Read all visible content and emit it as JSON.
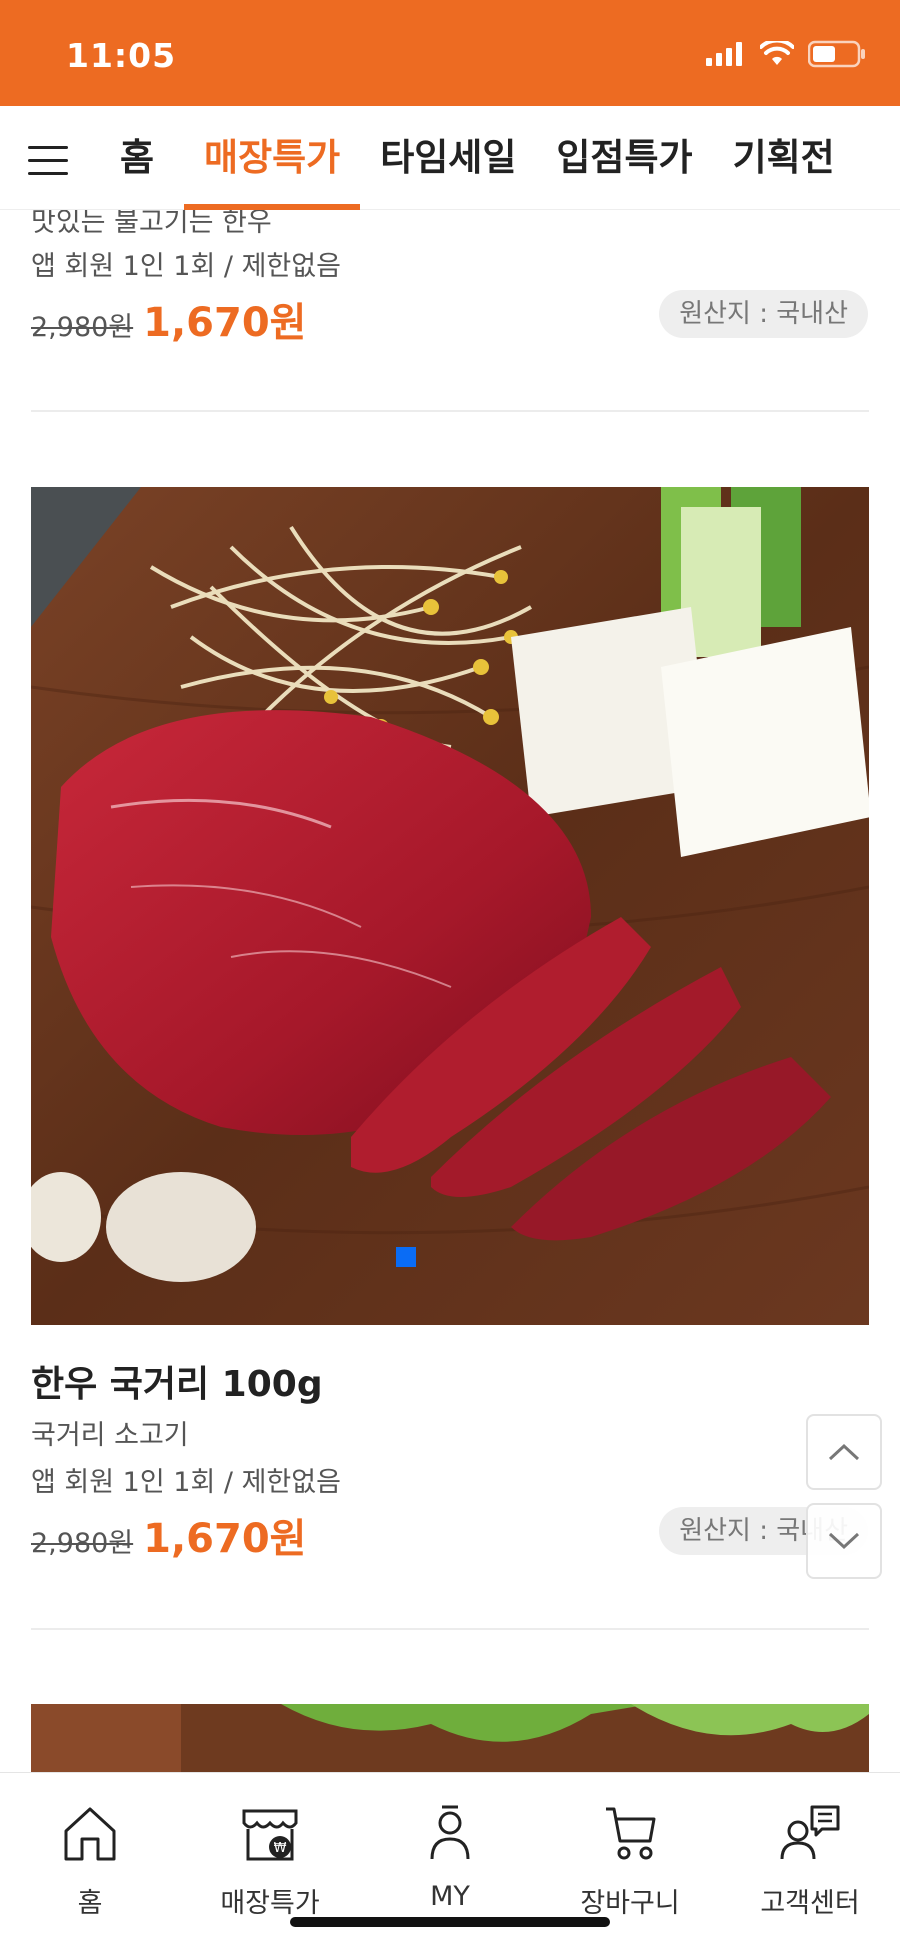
{
  "status_bar": {
    "time": "11:05",
    "icons": [
      "signal-icon",
      "wifi-icon",
      "battery-icon"
    ],
    "color": "#ed6b22"
  },
  "top_nav": {
    "menu_icon": "menu-icon",
    "tabs": [
      {
        "label": "홈",
        "active": false
      },
      {
        "label": "매장특가",
        "active": true
      },
      {
        "label": "타임세일",
        "active": false
      },
      {
        "label": "입점특가",
        "active": false
      },
      {
        "label": "기획전",
        "active": false
      }
    ],
    "accent": "#ed6b22"
  },
  "products": [
    {
      "description": "맛있는 불고기는 한우",
      "limit": "앱 회원 1인 1회 / 제한없음",
      "original_price": "2,980원",
      "sale_price": "1,670원",
      "origin": "원산지 : 국내산"
    },
    {
      "title": "한우 국거리 100g",
      "description": "국거리 소고기",
      "limit": "앱 회원 1인 1회 / 제한없음",
      "original_price": "2,980원",
      "sale_price": "1,670원",
      "origin": "원산지 : 국내산"
    }
  ],
  "scroll_buttons": {
    "up_icon": "chevron-up-icon",
    "down_icon": "chevron-down-icon"
  },
  "bottom_nav": {
    "items": [
      {
        "label": "홈",
        "icon": "home-icon"
      },
      {
        "label": "매장특가",
        "icon": "store-icon"
      },
      {
        "label": "MY",
        "icon": "user-icon"
      },
      {
        "label": "장바구니",
        "icon": "cart-icon"
      },
      {
        "label": "고객센터",
        "icon": "support-icon"
      }
    ]
  }
}
